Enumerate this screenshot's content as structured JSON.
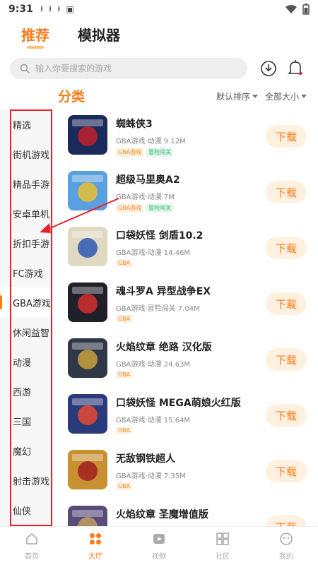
{
  "status": {
    "time": "9:31"
  },
  "top_tabs": [
    {
      "label": "推荐",
      "active": true
    },
    {
      "label": "模拟器",
      "active": false
    }
  ],
  "search": {
    "placeholder": "输入你要搜索的游戏"
  },
  "section": {
    "title": "分类",
    "sort_label": "默认排序",
    "size_label": "全部大小"
  },
  "sidebar": {
    "items": [
      {
        "label": "精选"
      },
      {
        "label": "街机游戏"
      },
      {
        "label": "精品手游"
      },
      {
        "label": "安卓单机"
      },
      {
        "label": "折扣手游"
      },
      {
        "label": "FC游戏"
      },
      {
        "label": "GBA游戏",
        "active": true
      },
      {
        "label": "休闲益智"
      },
      {
        "label": "动漫"
      },
      {
        "label": "西游"
      },
      {
        "label": "三国"
      },
      {
        "label": "魔幻"
      },
      {
        "label": "射击游戏"
      },
      {
        "label": "仙侠"
      }
    ]
  },
  "games": [
    {
      "name": "蜘蛛侠3",
      "meta": "GBA游戏·动漫  9.12M",
      "tags": [
        "GBA游戏",
        "冒险闯关"
      ],
      "tag_colors": [
        "orange",
        "green"
      ],
      "download_label": "下载",
      "thumb_color": "#1a2a5a",
      "thumb_accent": "#c0202a"
    },
    {
      "name": "超级马里奥A2",
      "meta": "GBA游戏·动漫  7M",
      "tags": [
        "GBA游戏",
        "冒险闯关"
      ],
      "tag_colors": [
        "orange",
        "green"
      ],
      "download_label": "下载",
      "thumb_color": "#5aa0e0",
      "thumb_accent": "#e8c030"
    },
    {
      "name": "口袋妖怪 剑盾10.2",
      "meta": "GBA游戏·动漫  14.46M",
      "tags": [
        "GBA"
      ],
      "tag_colors": [
        "orange"
      ],
      "download_label": "下载",
      "thumb_color": "#e0d8c0",
      "thumb_accent": "#2a5ab0"
    },
    {
      "name": "魂斗罗A 异型战争EX",
      "meta": "GBA游戏·冒险闯关  7.04M",
      "tags": [
        "GBA"
      ],
      "tag_colors": [
        "orange"
      ],
      "download_label": "下载",
      "thumb_color": "#202028",
      "thumb_accent": "#d03030"
    },
    {
      "name": "火焰纹章 绝路 汉化版",
      "meta": "GBA游戏·动漫  24.63M",
      "tags": [
        "GBA"
      ],
      "tag_colors": [
        "orange"
      ],
      "download_label": "下载",
      "thumb_color": "#303848",
      "thumb_accent": "#c8a040"
    },
    {
      "name": "口袋妖怪 MEGA萌娘火红版",
      "meta": "GBA游戏·动漫  15.64M",
      "tags": [
        "GBA"
      ],
      "tag_colors": [
        "orange"
      ],
      "download_label": "下载",
      "thumb_color": "#2a3a7a",
      "thumb_accent": "#e84a30"
    },
    {
      "name": "无敌钢铁超人",
      "meta": "GBA游戏·动漫  7.35M",
      "tags": [
        "GBA"
      ],
      "tag_colors": [
        "orange"
      ],
      "download_label": "下载",
      "thumb_color": "#c89030",
      "thumb_accent": "#a02020"
    },
    {
      "name": "火焰纹章 圣魔增值版",
      "meta": "",
      "tags": [],
      "tag_colors": [],
      "download_label": "下载",
      "thumb_color": "#5a4a7a",
      "thumb_accent": "#c0a060"
    }
  ],
  "bottom_nav": [
    {
      "label": "首页",
      "icon": "home-icon",
      "active": false
    },
    {
      "label": "大厅",
      "icon": "hall-icon",
      "active": true
    },
    {
      "label": "视频",
      "icon": "video-icon",
      "active": false
    },
    {
      "label": "社区",
      "icon": "community-icon",
      "active": false
    },
    {
      "label": "我的",
      "icon": "profile-icon",
      "active": false
    }
  ],
  "colors": {
    "accent": "#ff7a18",
    "annotation_red": "#e8202a"
  }
}
